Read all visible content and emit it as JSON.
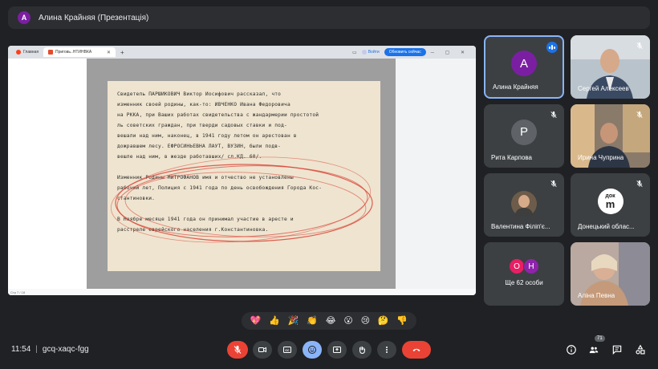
{
  "topbar": {
    "avatar_letter": "A",
    "title": "Алина Крайняя (Презентація)"
  },
  "browser": {
    "tab1": "Главная",
    "tab2": "Приговь..НТИНВКА",
    "signin": "Войти",
    "update": "Обновить сейчас",
    "status": "Стр 7 / 18"
  },
  "document": {
    "lines": [
      "Свидетель ПАРШИКОВИЧ Виктор Иосифович рассказал, что",
      "изменник своей родины, как-то: ИВЧЕНКО Ивана Федоровича",
      "на РККА, при Ваших работах свидетельства с жандармерии простотой",
      "ль советских граждан, при тверди садовых ставки и под-",
      "вешали над ним, наконец, в 1941 году летом он арестован в",
      "дожравшем лесу. ЕФРОСИНЬЕВНА ЛАУТ, ВУЗИН, были подв-",
      "вешле над ним, в жезде работавших/ сл.КД. 60/.",
      "",
      "Изменник Родины МИТРОФАНОВ имя и отчество не установлены",
      "рабочий лет, Полиция с 1941 года по день освобождения Города Кос-",
      "стантиновки.",
      "",
      "В Ноябре месяце 1941 года он принимал участие в аресте и",
      "расстреле еврейского населения г.Константиновка."
    ]
  },
  "tiles": [
    {
      "name": "Алина Крайняя",
      "letter": "A",
      "color": "#7b1fa2"
    },
    {
      "name": "Сергей Алексеев"
    },
    {
      "name": "Рита Карпова",
      "letter": "P",
      "color": "#5f6368"
    },
    {
      "name": "Ирина Чуприна"
    },
    {
      "name": "Валентина Філіп'є..."
    },
    {
      "name": "Донецький облас...",
      "logo_top": "док",
      "logo_bottom": "m"
    },
    {
      "name": "Ще 62 особи",
      "letters": [
        "O",
        "H"
      ],
      "colors": [
        "#e91e63",
        "#8e24aa"
      ]
    },
    {
      "name": "Аліна Певна"
    }
  ],
  "reactions": [
    "💖",
    "👍",
    "🎉",
    "👏",
    "😂",
    "😮",
    "😢",
    "🤔",
    "👎"
  ],
  "bottom": {
    "time": "11:54",
    "separator": "|",
    "meeting_code": "gcq-xaqc-fgg",
    "participants_count": "71"
  }
}
